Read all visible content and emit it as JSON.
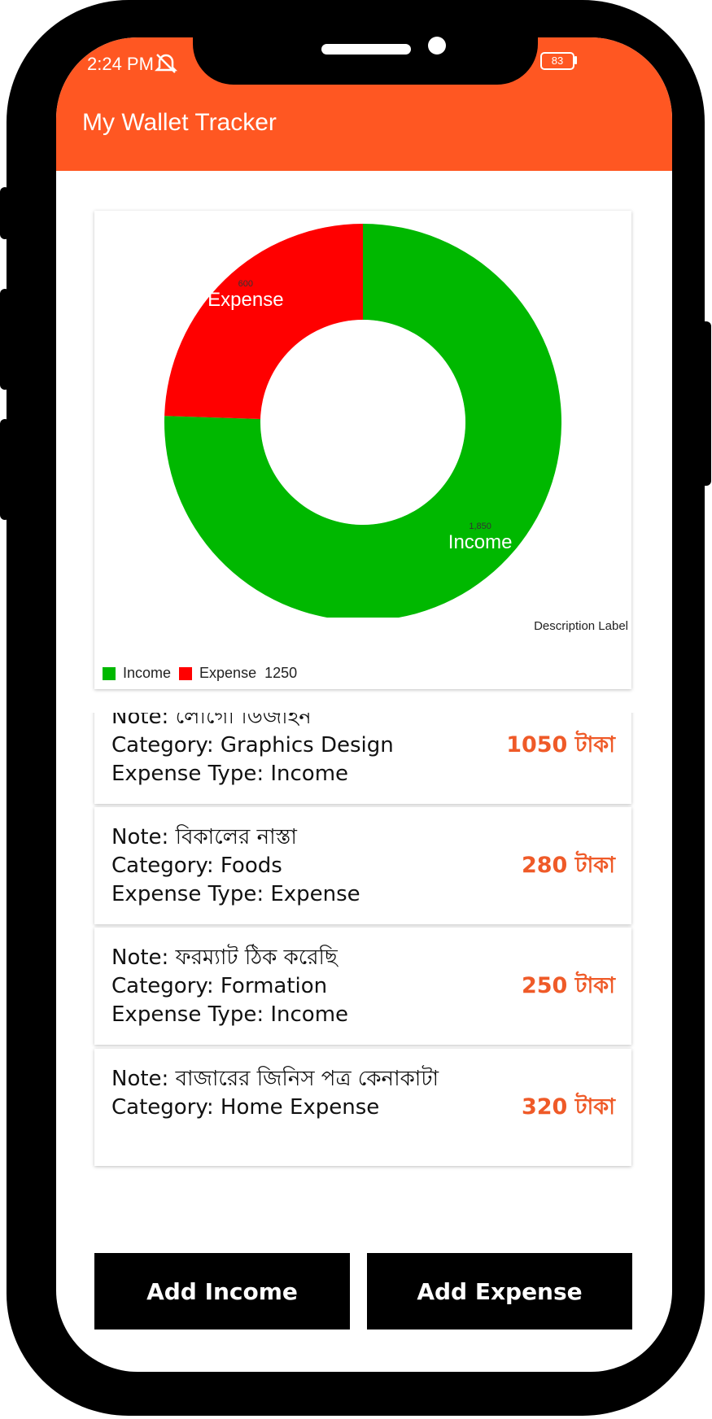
{
  "status_bar": {
    "time": "2:24 PM",
    "battery": "83",
    "icons": [
      "mute-icon",
      "signal-icon",
      "wifi-icon",
      "battery-icon"
    ]
  },
  "app_bar": {
    "title": "My Wallet Tracker",
    "color": "#ff5722"
  },
  "chart_data": {
    "type": "pie",
    "style": "donut",
    "slices": [
      {
        "label": "Income",
        "value": 1850,
        "value_label": "1,850",
        "color": "#00b800"
      },
      {
        "label": "Expense",
        "value": 600,
        "value_label": "600",
        "color": "#ff0000"
      }
    ],
    "description": "Description Label",
    "legend": [
      "Income",
      "Expense"
    ],
    "legend_position": "bottom-left",
    "legend_total": "1250"
  },
  "transactions": [
    {
      "note": "Note: লোগো ডিজাইন",
      "category": "Category: Graphics Design",
      "type": "Expense Type: Income",
      "amount": "1050 টাকা"
    },
    {
      "note": "Note: বিকালের নাস্তা",
      "category": "Category: Foods",
      "type": "Expense Type: Expense",
      "amount": "280 টাকা"
    },
    {
      "note": "Note: ফরম্যাট ঠিক করেছি",
      "category": "Category: Formation",
      "type": "Expense Type: Income",
      "amount": "250 টাকা"
    },
    {
      "note": "Note: বাজারের জিনিস পত্র কেনাকাটা",
      "category": "Category: Home Expense",
      "type": "",
      "amount": "320 টাকা"
    }
  ],
  "buttons": {
    "add_income": "Add Income",
    "add_expense": "Add Expense"
  },
  "colors": {
    "accent": "#ef5a28",
    "income": "#00b800",
    "expense": "#ff0000"
  }
}
